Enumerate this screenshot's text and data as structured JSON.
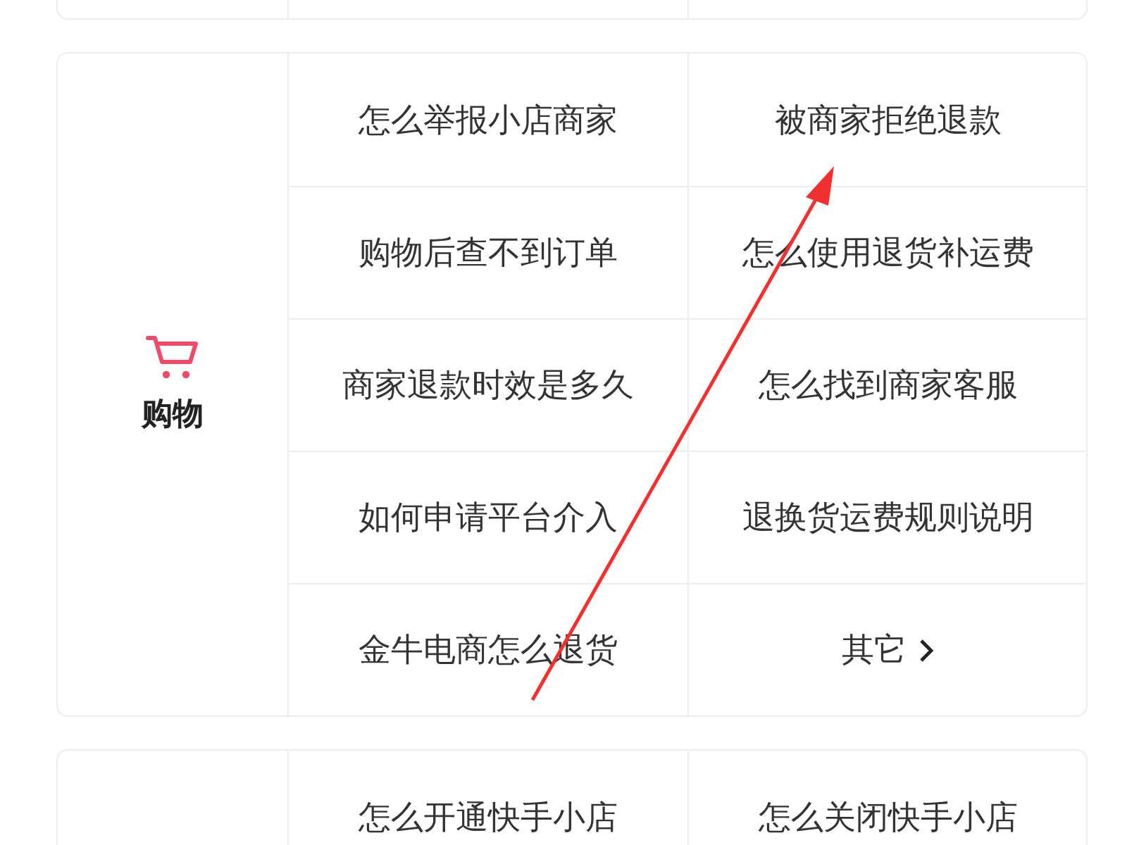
{
  "sections": [
    {
      "category": "购物",
      "questions": [
        {
          "kind": "question",
          "text": "怎么举报小店商家"
        },
        {
          "kind": "question",
          "text": "被商家拒绝退款"
        },
        {
          "kind": "question",
          "text": "购物后查不到订单"
        },
        {
          "kind": "question",
          "text": "怎么使用退货补运费"
        },
        {
          "kind": "question",
          "text": "商家退款时效是多久"
        },
        {
          "kind": "question",
          "text": "怎么找到商家客服"
        },
        {
          "kind": "question",
          "text": "如何申请平台介入"
        },
        {
          "kind": "question",
          "text": "退换货运费规则说明"
        },
        {
          "kind": "question",
          "text": "金牛电商怎么退货"
        },
        {
          "kind": "more",
          "text": "其它"
        }
      ]
    },
    {
      "questions": [
        {
          "kind": "question",
          "text": "怎么开通快手小店"
        },
        {
          "kind": "question",
          "text": "怎么关闭快手小店"
        }
      ]
    }
  ],
  "overlays": [
    {
      "kind": "arrow"
    }
  ]
}
